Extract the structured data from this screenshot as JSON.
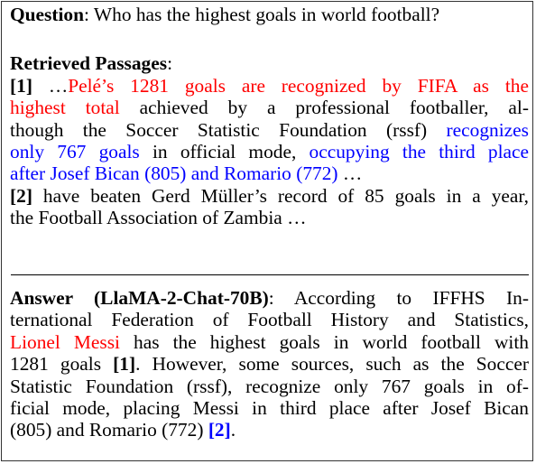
{
  "question": {
    "label": "Question",
    "colon": ":",
    "text": " Who has the highest goals in world football?"
  },
  "passages": {
    "label": "Retrieved Passages",
    "colon": ":",
    "lines": [
      {
        "cite": "[1]",
        "ellipsis": " …",
        "red": "Pelé’s 1281 goals are recognized by FIFA as the"
      },
      {
        "red": "highest total",
        "black": " achieved by a professional footballer, al-"
      },
      {
        "black": "though the Soccer Statistic Foundation (rssf) ",
        "blue": "recognizes"
      },
      {
        "blue1": "only 767 goals",
        "black": " in official mode, ",
        "blue2": "occupying the third place"
      },
      {
        "blue": "after Josef Bican (805) and Romario (772)",
        "black": " …"
      },
      {
        "cite": "[2]",
        "black": " have beaten Gerd Müller’s record of 85 goals in a year,"
      },
      {
        "black": "the Football Association of Zambia …"
      }
    ]
  },
  "answer": {
    "label": "Answer (LlaMA-2-Chat-70B)",
    "colon": ":",
    "lines": [
      {
        "label_suffix": " According to IFFHS In-"
      },
      {
        "black": "ternational Federation of Football History and Statistics,"
      },
      {
        "red": "Lionel Messi",
        "black": " has the highest goals in world football with"
      },
      {
        "black1": "1281 goals ",
        "cite": "[1]",
        "black2": ". However, some sources, such as the Soccer"
      },
      {
        "black": "Statistic Foundation (rssf), recognize only 767 goals in of-"
      },
      {
        "black": "ficial mode, placing Messi in third place after Josef Bican"
      },
      {
        "black": "(805) and Romario (772) ",
        "cite": "[2]",
        "end": "."
      }
    ]
  },
  "colors": {
    "highlight_red": "#ff0000",
    "highlight_blue": "#0000ff",
    "text": "#000000",
    "border": "#333333"
  }
}
